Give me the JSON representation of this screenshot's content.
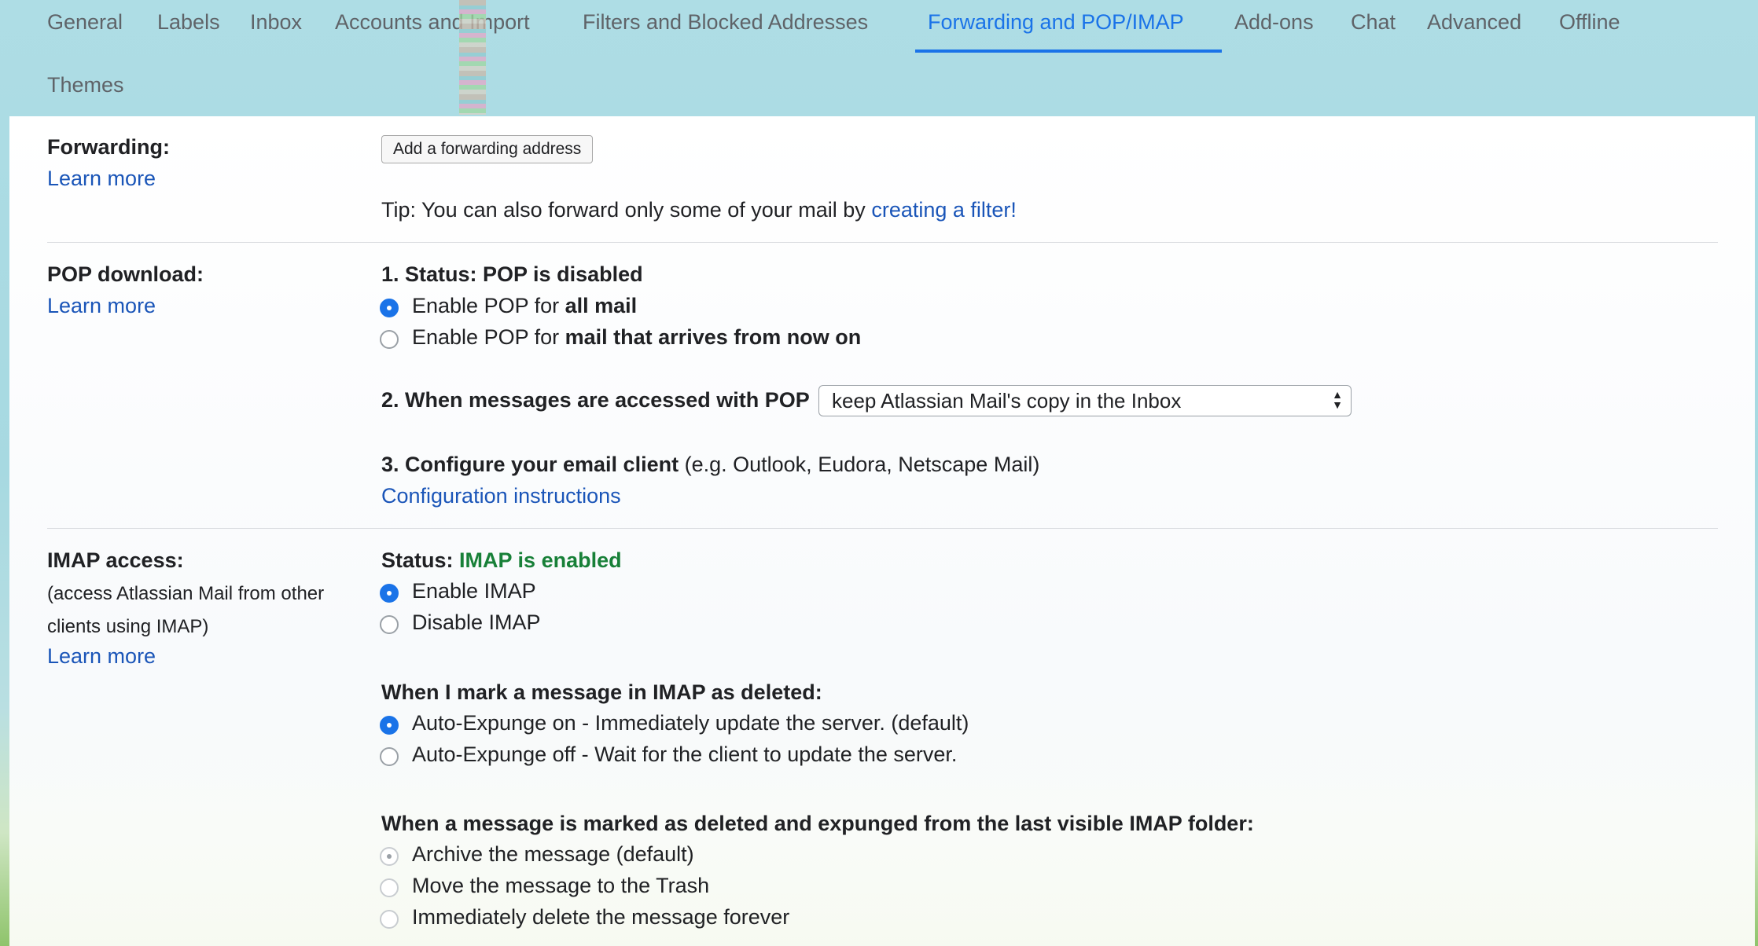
{
  "tabs": {
    "general": "General",
    "labels": "Labels",
    "inbox": "Inbox",
    "accounts": "Accounts and Import",
    "filters": "Filters and Blocked Addresses",
    "forwarding": "Forwarding and POP/IMAP",
    "addons": "Add-ons",
    "chat": "Chat",
    "advanced": "Advanced",
    "offline": "Offline",
    "themes": "Themes"
  },
  "forwarding": {
    "label": "Forwarding:",
    "learn_more": "Learn more",
    "add_button": "Add a forwarding address",
    "tip_prefix": "Tip: You can also forward only some of your mail by",
    "tip_link": "creating a filter!"
  },
  "pop": {
    "label": "POP download:",
    "learn_more": "Learn more",
    "status": "1. Status: POP is disabled",
    "opt1_prefix": "Enable POP for",
    "opt1_bold": "all mail",
    "opt2_prefix": "Enable POP for",
    "opt2_bold": "mail that arrives from now on",
    "when_label": "2. When messages are accessed with POP",
    "when_select": "keep Atlassian Mail's copy in the Inbox",
    "configure_bold": "3. Configure your email client",
    "configure_rest": "(e.g. Outlook, Eudora, Netscape Mail)",
    "config_link": "Configuration instructions"
  },
  "imap": {
    "label": "IMAP access:",
    "desc_line1": "(access Atlassian Mail from other",
    "desc_line2": "clients using IMAP)",
    "learn_more": "Learn more",
    "status_label": "Status:",
    "status_value": "IMAP is enabled",
    "enable": "Enable IMAP",
    "disable": "Disable IMAP",
    "deleted_heading": "When I mark a message in IMAP as deleted:",
    "expunge_on": "Auto-Expunge on - Immediately update the server. (default)",
    "expunge_off": "Auto-Expunge off - Wait for the client to update the server.",
    "expunged_heading": "When a message is marked as deleted and expunged from the last visible IMAP folder:",
    "archive": "Archive the message (default)",
    "trash": "Move the message to the Trash",
    "delete_forever": "Immediately delete the message forever"
  },
  "colors": {
    "accent": "#1a73e8",
    "link": "#1a55b8",
    "enabled_green": "#188038",
    "tab_bar_bg": "#aedde5"
  }
}
